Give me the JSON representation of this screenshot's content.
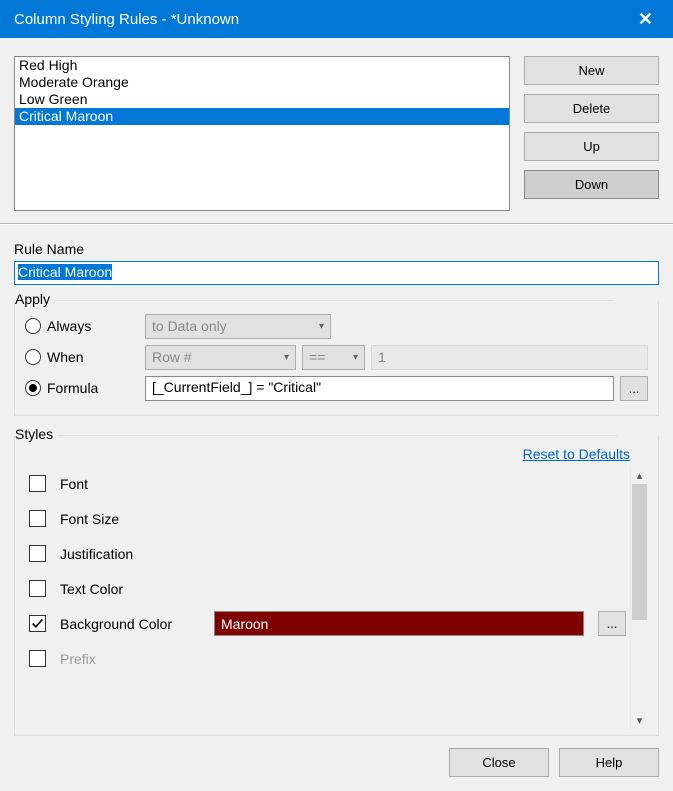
{
  "title": "Column Styling Rules - *Unknown",
  "buttons": {
    "new": "New",
    "delete": "Delete",
    "up": "Up",
    "down": "Down",
    "close": "Close",
    "help": "Help",
    "ellipsis": "..."
  },
  "rules": {
    "items": [
      "Red High",
      "Moderate Orange",
      "Low Green",
      "Critical Maroon"
    ],
    "selectedIndex": 3
  },
  "labels": {
    "ruleName": "Rule Name",
    "apply": "Apply",
    "styles": "Styles",
    "resetDefaults": "Reset to Defaults"
  },
  "ruleName": "Critical Maroon",
  "apply": {
    "mode": "formula",
    "always": "Always",
    "when": "When",
    "formula": "Formula",
    "dataOnly": "to Data only",
    "rowNum": "Row #",
    "op": "==",
    "rowValue": "1",
    "formulaText": "[_CurrentField_] = \"Critical\""
  },
  "styles": {
    "items": [
      {
        "label": "Font",
        "checked": false
      },
      {
        "label": "Font Size",
        "checked": false
      },
      {
        "label": "Justification",
        "checked": false
      },
      {
        "label": "Text Color",
        "checked": false
      },
      {
        "label": "Background Color",
        "checked": true,
        "colorName": "Maroon",
        "colorHex": "#800000"
      },
      {
        "label": "Prefix",
        "checked": false,
        "faded": true
      }
    ]
  }
}
